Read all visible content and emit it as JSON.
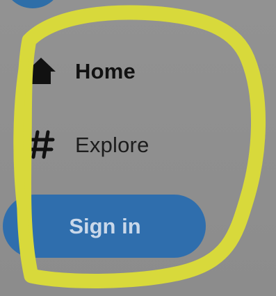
{
  "nav": {
    "items": [
      {
        "label": "Home",
        "icon": "home-icon"
      },
      {
        "label": "Explore",
        "icon": "hash-icon"
      }
    ]
  },
  "actions": {
    "sign_in_label": "Sign in"
  },
  "colors": {
    "background": "#8e8e8e",
    "brand_blue": "#2f6ead",
    "annotation_yellow": "#d8d93b",
    "text_dark": "#111111"
  }
}
